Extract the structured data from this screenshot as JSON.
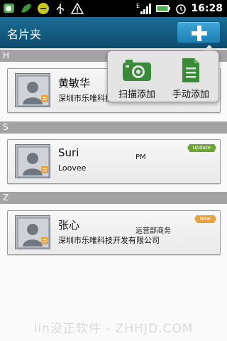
{
  "status_bar": {
    "time": "16:28",
    "signal_letter": "E",
    "icons": [
      "chat-app-icon",
      "leaf-icon",
      "bean-icon",
      "usb-icon",
      "warning-icon",
      "signal-icon",
      "battery-icon",
      "alarm-icon"
    ]
  },
  "header": {
    "title": "名片夹",
    "add_icon": "plus-icon"
  },
  "popup_menu": {
    "items": [
      {
        "label": "扫描添加",
        "icon": "camera-icon"
      },
      {
        "label": "手动添加",
        "icon": "document-icon"
      }
    ]
  },
  "sections": [
    {
      "letter": "H",
      "contacts": [
        {
          "name": "黄敏华",
          "company": "深圳市乐唯科技开发有限公司",
          "title": "",
          "tag": ""
        }
      ]
    },
    {
      "letter": "S",
      "contacts": [
        {
          "name": "Suri",
          "company": "Loovee",
          "title": "PM",
          "tag": "Update"
        }
      ]
    },
    {
      "letter": "Z",
      "contacts": [
        {
          "name": "张心",
          "company": "深圳市乐唯科技开发有限公司",
          "title": "运营部商务",
          "tag": "New"
        }
      ]
    }
  ],
  "watermark": "lin没正软件 - ZHHJD.COM",
  "colors": {
    "titlebar": "#1b6d96",
    "add_button": "#2e93c7",
    "section_header": "#a3a3a3",
    "tag_update": "#6da534",
    "tag_new": "#e8a33d",
    "icon_green": "#3a8a3a"
  }
}
